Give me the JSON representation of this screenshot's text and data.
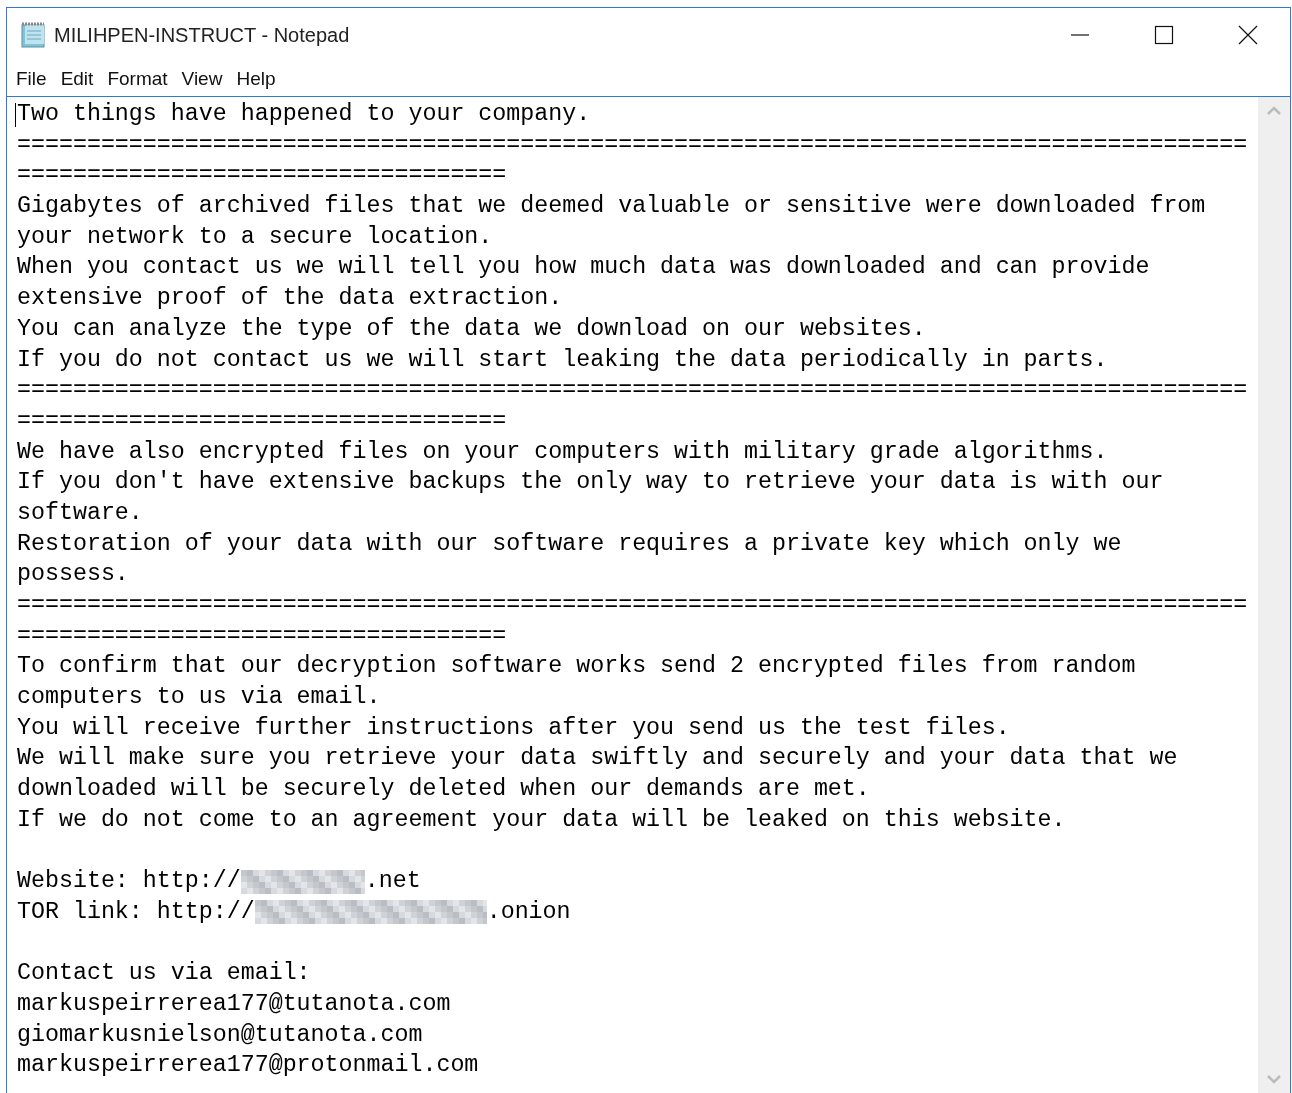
{
  "window": {
    "title": "MILIHPEN-INSTRUCT - Notepad"
  },
  "menu": [
    "File",
    "Edit",
    "Format",
    "View",
    "Help"
  ],
  "lines": [
    {
      "kind": "text",
      "text": "Two things have happened to your company."
    },
    {
      "kind": "text",
      "text": "========================================================================================"
    },
    {
      "kind": "text",
      "text": "==================================="
    },
    {
      "kind": "text",
      "text": "Gigabytes of archived files that we deemed valuable or sensitive were downloaded from"
    },
    {
      "kind": "text",
      "text": "your network to a secure location."
    },
    {
      "kind": "text",
      "text": "When you contact us we will tell you how much data was downloaded and can provide"
    },
    {
      "kind": "text",
      "text": "extensive proof of the data extraction."
    },
    {
      "kind": "text",
      "text": "You can analyze the type of the data we download on our websites."
    },
    {
      "kind": "text",
      "text": "If you do not contact us we will start leaking the data periodically in parts."
    },
    {
      "kind": "text",
      "text": "========================================================================================"
    },
    {
      "kind": "text",
      "text": "==================================="
    },
    {
      "kind": "text",
      "text": "We have also encrypted files on your computers with military grade algorithms."
    },
    {
      "kind": "text",
      "text": "If you don't have extensive backups the only way to retrieve your data is with our"
    },
    {
      "kind": "text",
      "text": "software."
    },
    {
      "kind": "text",
      "text": "Restoration of your data with our software requires a private key which only we"
    },
    {
      "kind": "text",
      "text": "possess."
    },
    {
      "kind": "text",
      "text": "========================================================================================"
    },
    {
      "kind": "text",
      "text": "==================================="
    },
    {
      "kind": "text",
      "text": "To confirm that our decryption software works send 2 encrypted files from random"
    },
    {
      "kind": "text",
      "text": "computers to us via email."
    },
    {
      "kind": "text",
      "text": "You will receive further instructions after you send us the test files."
    },
    {
      "kind": "text",
      "text": "We will make sure you retrieve your data swiftly and securely and your data that we"
    },
    {
      "kind": "text",
      "text": "downloaded will be securely deleted when our demands are met."
    },
    {
      "kind": "text",
      "text": "If we do not come to an agreement your data will be leaked on this website."
    },
    {
      "kind": "blank"
    },
    {
      "kind": "redacted",
      "before": "Website: http://",
      "after": ".net"
    },
    {
      "kind": "redacted",
      "before": "TOR link: http://",
      "after": ".onion"
    },
    {
      "kind": "blank"
    },
    {
      "kind": "text",
      "text": "Contact us via email:"
    },
    {
      "kind": "text",
      "text": "markuspeirrerea177@tutanota.com"
    },
    {
      "kind": "text",
      "text": "giomarkusnielson@tutanota.com"
    },
    {
      "kind": "text",
      "text": "markuspeirrerea177@protonmail.com"
    }
  ]
}
